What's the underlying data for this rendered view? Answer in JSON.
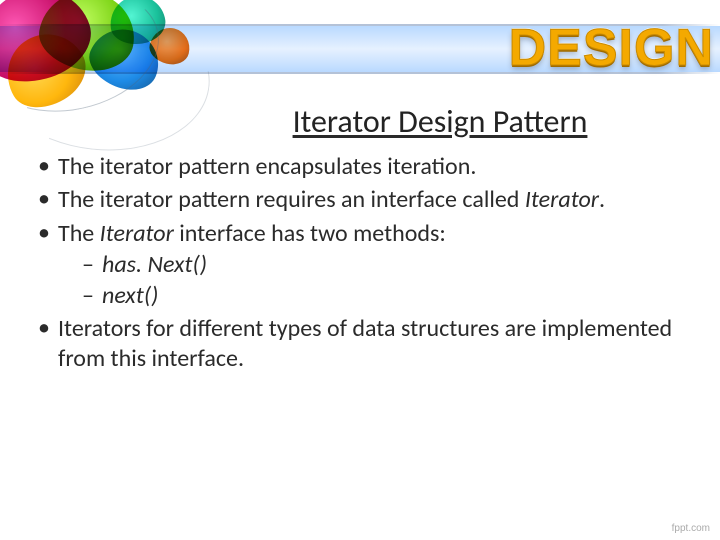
{
  "header": {
    "wordmark": "DESIGN"
  },
  "title": "Iterator Design Pattern",
  "bullets": [
    {
      "text": "The iterator pattern encapsulates iteration."
    },
    {
      "prefix": "The iterator pattern requires an interface called ",
      "italic": "Iterator",
      "suffix": "."
    },
    {
      "prefix": "The ",
      "italic": "Iterator",
      "suffix": " interface has two methods:",
      "sub": [
        {
          "italic": "has. Next()"
        },
        {
          "italic": "next()"
        }
      ]
    },
    {
      "text": "Iterators for different types of data structures are implemented from this interface."
    }
  ],
  "footer": "fppt.com"
}
